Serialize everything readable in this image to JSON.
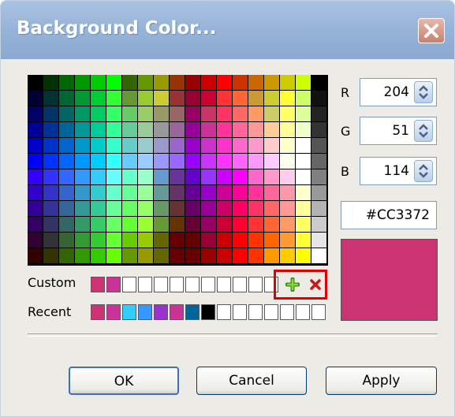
{
  "window": {
    "title": "Background Color...",
    "close_icon": "close-x-icon"
  },
  "palette": {
    "rows": [
      [
        "#000000",
        "#003300",
        "#006600",
        "#009900",
        "#00cc00",
        "#00ff00",
        "#336600",
        "#669900",
        "#999900",
        "#993300",
        "#990000",
        "#cc0000",
        "#ff0000",
        "#cc3300",
        "#cc6600",
        "#cc9900",
        "#cccc00",
        "#ccff00",
        "#000000"
      ],
      [
        "#000033",
        "#003333",
        "#006633",
        "#009933",
        "#00cc33",
        "#33ff33",
        "#669933",
        "#99cc33",
        "#cccc33",
        "#993333",
        "#990033",
        "#cc0033",
        "#ff3333",
        "#ff6633",
        "#cc9933",
        "#cccc33",
        "#ffff33",
        "#ccff66",
        "#111111"
      ],
      [
        "#000066",
        "#003366",
        "#006666",
        "#009966",
        "#00cc66",
        "#33ff66",
        "#66cc66",
        "#99cc66",
        "#999966",
        "#996666",
        "#990066",
        "#cc3366",
        "#ff3366",
        "#ff6666",
        "#ff9966",
        "#cccc66",
        "#ffff66",
        "#ddff99",
        "#222222"
      ],
      [
        "#000099",
        "#003399",
        "#006699",
        "#009999",
        "#00cc99",
        "#33ff99",
        "#66cc99",
        "#99cc99",
        "#999999",
        "#996699",
        "#990099",
        "#cc3399",
        "#ff3399",
        "#ff6699",
        "#ff9999",
        "#ffcc99",
        "#ffff99",
        "#eeffcc",
        "#333333"
      ],
      [
        "#0000cc",
        "#0033cc",
        "#0066cc",
        "#0099cc",
        "#00cccc",
        "#33ffcc",
        "#66cccc",
        "#99cccc",
        "#9999cc",
        "#9966cc",
        "#9900cc",
        "#cc33cc",
        "#ff33cc",
        "#ff66cc",
        "#ff99cc",
        "#ffcccc",
        "#ffffcc",
        "#ffffff",
        "#555555"
      ],
      [
        "#0000ff",
        "#0033ff",
        "#0066ff",
        "#0099ff",
        "#00ccff",
        "#33ffff",
        "#66ccff",
        "#99ccff",
        "#9999ff",
        "#9966ff",
        "#9900ff",
        "#cc33ff",
        "#ff33ff",
        "#ff66ff",
        "#ff99ff",
        "#ffccff",
        "#ffffee",
        "#ffffff",
        "#666666"
      ],
      [
        "#3300ff",
        "#3333ff",
        "#3366ff",
        "#3399ff",
        "#33ccff",
        "#66ffff",
        "#66ffcc",
        "#99ffcc",
        "#6699cc",
        "#663399",
        "#6600cc",
        "#9933ff",
        "#cc00ff",
        "#ff00ff",
        "#ff66cc",
        "#ff99cc",
        "#ffccee",
        "#ffffff",
        "#808080"
      ],
      [
        "#3300cc",
        "#3333cc",
        "#3366cc",
        "#3399cc",
        "#33cccc",
        "#66ffcc",
        "#66ff99",
        "#99ff99",
        "#669999",
        "#663366",
        "#660099",
        "#9900cc",
        "#cc0099",
        "#ff0099",
        "#ff3399",
        "#ff6699",
        "#ff99aa",
        "#ffffcc",
        "#999999"
      ],
      [
        "#330099",
        "#333399",
        "#336699",
        "#339999",
        "#33cc99",
        "#66ff99",
        "#66ff66",
        "#99ff66",
        "#669966",
        "#663333",
        "#660066",
        "#990099",
        "#cc0066",
        "#ff0066",
        "#ff3366",
        "#ff6666",
        "#ff9999",
        "#ffff99",
        "#b3b3b3"
      ],
      [
        "#330066",
        "#333366",
        "#336666",
        "#339966",
        "#33cc66",
        "#66ff66",
        "#66ff33",
        "#99ff33",
        "#669933",
        "#663300",
        "#660033",
        "#990066",
        "#cc0033",
        "#ff0033",
        "#ff3333",
        "#ff6633",
        "#ff9966",
        "#ffff66",
        "#cccccc"
      ],
      [
        "#330033",
        "#333333",
        "#336633",
        "#339933",
        "#33cc33",
        "#66ff33",
        "#66cc00",
        "#99cc00",
        "#666600",
        "#660000",
        "#660000",
        "#990033",
        "#cc0000",
        "#ff0000",
        "#ff3300",
        "#ff6600",
        "#ff9933",
        "#ffff33",
        "#e6e6e6"
      ],
      [
        "#330000",
        "#333300",
        "#336600",
        "#339900",
        "#33cc00",
        "#66ff00",
        "#669900",
        "#999900",
        "#666600",
        "#660000",
        "#660000",
        "#990000",
        "#cc0000",
        "#ff0000",
        "#ff3300",
        "#ff9900",
        "#ffcc00",
        "#ffff00",
        "#ffffff"
      ]
    ]
  },
  "custom": {
    "label": "Custom",
    "swatches": [
      "#cc3372",
      "#cc3399",
      "#ffffff",
      "#ffffff",
      "#ffffff",
      "#ffffff",
      "#ffffff",
      "#ffffff",
      "#ffffff",
      "#ffffff",
      "#ffffff",
      "#ffffff"
    ],
    "add_icon": "green-plus-icon",
    "remove_icon": "red-x-icon"
  },
  "recent": {
    "label": "Recent",
    "swatches": [
      "#cc3372",
      "#cc3399",
      "#33ccff",
      "#3399ff",
      "#9933cc",
      "#cc3399",
      "#006699",
      "#000000",
      "#ffffff",
      "#ffffff",
      "#ffffff",
      "#ffffff",
      "#ffffff",
      "#ffffff",
      "#ffffff"
    ]
  },
  "rgb": {
    "r_label": "R",
    "g_label": "G",
    "b_label": "B",
    "r_value": "204",
    "g_value": "51",
    "b_value": "114",
    "spin_icon": "up-down-arrows-icon"
  },
  "hex": "#CC3372",
  "preview_color": "#CC3372",
  "buttons": {
    "ok": "OK",
    "cancel": "Cancel",
    "apply": "Apply"
  }
}
